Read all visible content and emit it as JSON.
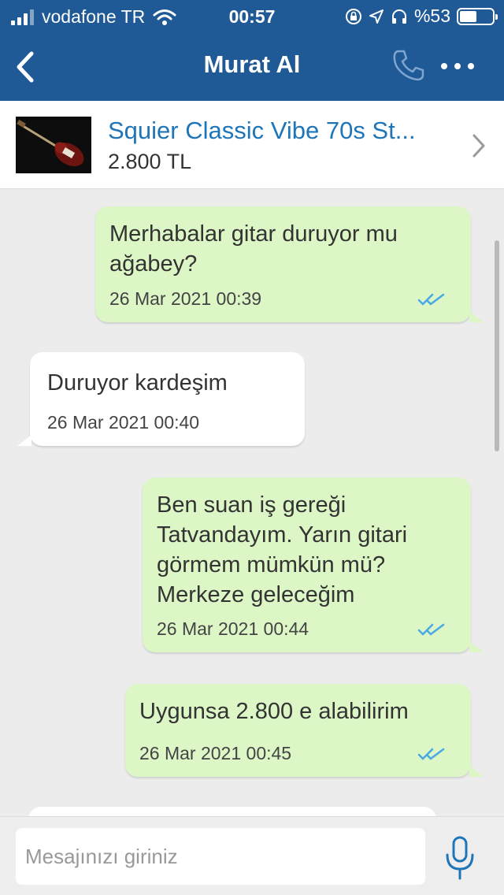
{
  "status_bar": {
    "carrier": "vodafone TR",
    "time": "00:57",
    "battery": "%53",
    "battery_level": 0.53
  },
  "nav": {
    "title": "Murat Al",
    "icons": [
      "back-chevron-icon",
      "phone-icon",
      "more-icon"
    ]
  },
  "product": {
    "title": "Squier Classic Vibe 70s St...",
    "price": "2.800 TL",
    "thumbnail": "guitar-thumbnail"
  },
  "messages": [
    {
      "direction": "out",
      "text": "Merhabalar gitar duruyor mu ağabey?",
      "time": "26 Mar 2021 00:39",
      "read": true
    },
    {
      "direction": "in",
      "text": "Duruyor kardeşim",
      "time": "26 Mar 2021 00:40"
    },
    {
      "direction": "out",
      "text": "Ben suan iş gereği Tatvandayım. Yarın gitari görmem mümkün mü? Merkeze geleceğim",
      "time": "26 Mar 2021 00:44",
      "read": true
    },
    {
      "direction": "out",
      "text": "Uygunsa 2.800 e alabilirim",
      "time": "26 Mar 2021 00:45",
      "read": true
    }
  ],
  "composer": {
    "placeholder": "Mesajınızı giriniz"
  },
  "colors": {
    "header": "#1f5996",
    "outgoing_bubble": "#dcf6c6",
    "incoming_bubble": "#ffffff",
    "link": "#1e75b8",
    "read_ticks": "#48a9e6"
  }
}
